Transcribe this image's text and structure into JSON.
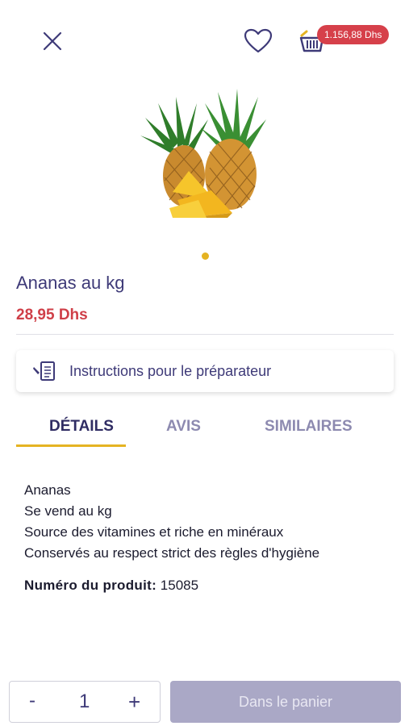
{
  "header": {
    "close_icon": "close-icon",
    "favorite_icon": "heart-icon",
    "cart_icon": "basket-icon",
    "cart_total": "1.156,88 Dhs"
  },
  "product": {
    "image": "pineapple-image",
    "name": "Ananas au kg",
    "price": "28,95 Dhs"
  },
  "instructions": {
    "icon": "notes-icon",
    "label": "Instructions pour le préparateur"
  },
  "tabs": [
    {
      "label": "DÉTAILS",
      "active": true
    },
    {
      "label": "AVIS",
      "active": false
    },
    {
      "label": "SIMILAIRES",
      "active": false
    }
  ],
  "details": {
    "lines": [
      "Ananas",
      "Se vend au kg",
      "Source des vitamines et riche en minéraux",
      "Conservés au respect strict des règles d'hygiène"
    ],
    "product_number_label": "Numéro du produit:",
    "product_number": "15085"
  },
  "footer": {
    "minus_label": "-",
    "quantity": "1",
    "plus_label": "+",
    "add_to_cart_label": "Dans le panier"
  },
  "colors": {
    "accent": "#e5b322",
    "brand": "#3e3a78",
    "price": "#cf3f48"
  }
}
